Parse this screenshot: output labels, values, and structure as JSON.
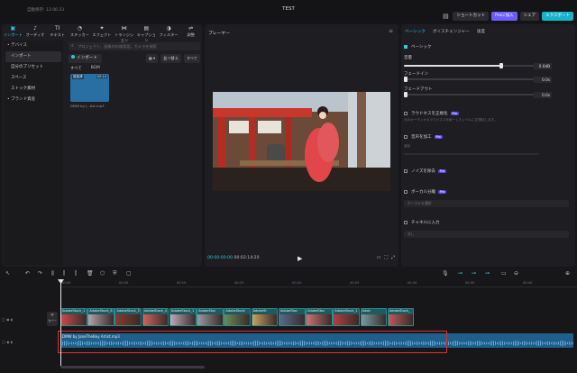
{
  "titlebar": {
    "autosave": "自動保存: 13:06:33",
    "project": "TEST",
    "shortcut": "ショートカット",
    "pro": "Proに加入",
    "share": "シェア",
    "export": "エクスポート"
  },
  "media_toolbar": [
    {
      "label": "インポート",
      "glyph": "▣"
    },
    {
      "label": "オーディオ",
      "glyph": "♪"
    },
    {
      "label": "テキスト",
      "glyph": "TI"
    },
    {
      "label": "ステッカー",
      "glyph": "◔"
    },
    {
      "label": "エフェクト",
      "glyph": "✦"
    },
    {
      "label": "トランジション",
      "glyph": "⋈"
    },
    {
      "label": "キャプション",
      "glyph": "▤"
    },
    {
      "label": "フィルター",
      "glyph": "◑"
    },
    {
      "label": "調整",
      "glyph": "⇌"
    }
  ],
  "media_sidebar": {
    "device": "• デバイス",
    "import": "インポート",
    "presets": "自分のプリセット",
    "spaces": "スペース",
    "stock": "ストック素材",
    "brand": "• ブランド資産"
  },
  "media": {
    "search_placeholder": "プロジェクト、画像内の検索語、カメラを検索",
    "import_btn": "インポート",
    "sort": "並べ替え",
    "all_btn": "すべて",
    "filter_all": "すべて",
    "filter_bgm": "BGM",
    "thumb_tag": "追加済",
    "thumb_duration": "02:14",
    "thumb_name": "DMW by J...tist.mp3"
  },
  "player": {
    "title": "プレーヤー",
    "current_time": "00:00:00:00",
    "duration": "00:02:14:20"
  },
  "details": {
    "tabs": [
      "ベーシック",
      "ボイスチェンジャー",
      "速度"
    ],
    "basic": "ベーシック",
    "volume": "音量",
    "volume_value": "0.0dB",
    "volume_level": 0.72,
    "fade_in": "フェードイン",
    "fade_in_value": "0.0s",
    "fade_out": "フェードアウト",
    "fade_out_value": "0.0s",
    "loudness": "ラウドネスを正規化",
    "loudness_sub": "元のオーディオのラウドネスを統一したレベルに正規化します。",
    "enhance": "音声を加工",
    "enhance_sub": "強化",
    "denoise": "ノイズを除去",
    "vocal": "ボーカル分離",
    "vocal_select": "ボーカルを選択",
    "channel": "チャネルに入力",
    "channel_select": "なし",
    "pro_badge": "Pro"
  },
  "timeline": {
    "ruler": [
      "00:00",
      "00:05",
      "00:10",
      "00:15",
      "00:20",
      "00:25",
      "00:30",
      "00:35",
      "00:40"
    ],
    "cover": "カバー",
    "video_clips": [
      "AdobeStock_1",
      "AdobeStock_8",
      "AdobeStock_5",
      "AdobeStock_4",
      "AdobeStock_1",
      "AdobeStoc",
      "AdobeStock",
      "AdobeSt",
      "AdobeStoc",
      "AdobeStoc",
      "AdobeStock_1",
      "Adob",
      "AdobeStock_"
    ],
    "audio_clip": "DMW by JaneTheBoy Artist.mp3"
  }
}
